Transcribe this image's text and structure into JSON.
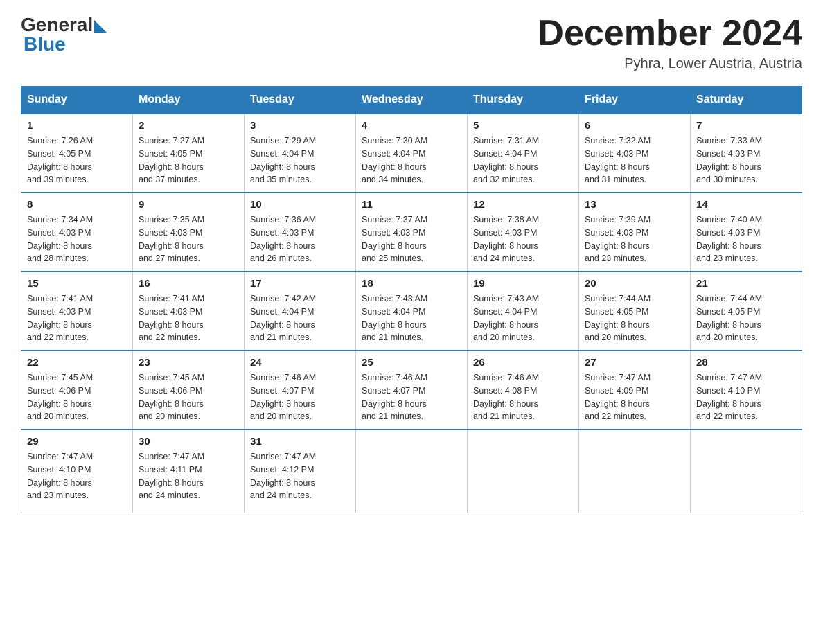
{
  "logo": {
    "general": "General",
    "blue": "Blue"
  },
  "header": {
    "month_year": "December 2024",
    "location": "Pyhra, Lower Austria, Austria"
  },
  "days_of_week": [
    "Sunday",
    "Monday",
    "Tuesday",
    "Wednesday",
    "Thursday",
    "Friday",
    "Saturday"
  ],
  "weeks": [
    [
      {
        "day": "1",
        "info": "Sunrise: 7:26 AM\nSunset: 4:05 PM\nDaylight: 8 hours\nand 39 minutes."
      },
      {
        "day": "2",
        "info": "Sunrise: 7:27 AM\nSunset: 4:05 PM\nDaylight: 8 hours\nand 37 minutes."
      },
      {
        "day": "3",
        "info": "Sunrise: 7:29 AM\nSunset: 4:04 PM\nDaylight: 8 hours\nand 35 minutes."
      },
      {
        "day": "4",
        "info": "Sunrise: 7:30 AM\nSunset: 4:04 PM\nDaylight: 8 hours\nand 34 minutes."
      },
      {
        "day": "5",
        "info": "Sunrise: 7:31 AM\nSunset: 4:04 PM\nDaylight: 8 hours\nand 32 minutes."
      },
      {
        "day": "6",
        "info": "Sunrise: 7:32 AM\nSunset: 4:03 PM\nDaylight: 8 hours\nand 31 minutes."
      },
      {
        "day": "7",
        "info": "Sunrise: 7:33 AM\nSunset: 4:03 PM\nDaylight: 8 hours\nand 30 minutes."
      }
    ],
    [
      {
        "day": "8",
        "info": "Sunrise: 7:34 AM\nSunset: 4:03 PM\nDaylight: 8 hours\nand 28 minutes."
      },
      {
        "day": "9",
        "info": "Sunrise: 7:35 AM\nSunset: 4:03 PM\nDaylight: 8 hours\nand 27 minutes."
      },
      {
        "day": "10",
        "info": "Sunrise: 7:36 AM\nSunset: 4:03 PM\nDaylight: 8 hours\nand 26 minutes."
      },
      {
        "day": "11",
        "info": "Sunrise: 7:37 AM\nSunset: 4:03 PM\nDaylight: 8 hours\nand 25 minutes."
      },
      {
        "day": "12",
        "info": "Sunrise: 7:38 AM\nSunset: 4:03 PM\nDaylight: 8 hours\nand 24 minutes."
      },
      {
        "day": "13",
        "info": "Sunrise: 7:39 AM\nSunset: 4:03 PM\nDaylight: 8 hours\nand 23 minutes."
      },
      {
        "day": "14",
        "info": "Sunrise: 7:40 AM\nSunset: 4:03 PM\nDaylight: 8 hours\nand 23 minutes."
      }
    ],
    [
      {
        "day": "15",
        "info": "Sunrise: 7:41 AM\nSunset: 4:03 PM\nDaylight: 8 hours\nand 22 minutes."
      },
      {
        "day": "16",
        "info": "Sunrise: 7:41 AM\nSunset: 4:03 PM\nDaylight: 8 hours\nand 22 minutes."
      },
      {
        "day": "17",
        "info": "Sunrise: 7:42 AM\nSunset: 4:04 PM\nDaylight: 8 hours\nand 21 minutes."
      },
      {
        "day": "18",
        "info": "Sunrise: 7:43 AM\nSunset: 4:04 PM\nDaylight: 8 hours\nand 21 minutes."
      },
      {
        "day": "19",
        "info": "Sunrise: 7:43 AM\nSunset: 4:04 PM\nDaylight: 8 hours\nand 20 minutes."
      },
      {
        "day": "20",
        "info": "Sunrise: 7:44 AM\nSunset: 4:05 PM\nDaylight: 8 hours\nand 20 minutes."
      },
      {
        "day": "21",
        "info": "Sunrise: 7:44 AM\nSunset: 4:05 PM\nDaylight: 8 hours\nand 20 minutes."
      }
    ],
    [
      {
        "day": "22",
        "info": "Sunrise: 7:45 AM\nSunset: 4:06 PM\nDaylight: 8 hours\nand 20 minutes."
      },
      {
        "day": "23",
        "info": "Sunrise: 7:45 AM\nSunset: 4:06 PM\nDaylight: 8 hours\nand 20 minutes."
      },
      {
        "day": "24",
        "info": "Sunrise: 7:46 AM\nSunset: 4:07 PM\nDaylight: 8 hours\nand 20 minutes."
      },
      {
        "day": "25",
        "info": "Sunrise: 7:46 AM\nSunset: 4:07 PM\nDaylight: 8 hours\nand 21 minutes."
      },
      {
        "day": "26",
        "info": "Sunrise: 7:46 AM\nSunset: 4:08 PM\nDaylight: 8 hours\nand 21 minutes."
      },
      {
        "day": "27",
        "info": "Sunrise: 7:47 AM\nSunset: 4:09 PM\nDaylight: 8 hours\nand 22 minutes."
      },
      {
        "day": "28",
        "info": "Sunrise: 7:47 AM\nSunset: 4:10 PM\nDaylight: 8 hours\nand 22 minutes."
      }
    ],
    [
      {
        "day": "29",
        "info": "Sunrise: 7:47 AM\nSunset: 4:10 PM\nDaylight: 8 hours\nand 23 minutes."
      },
      {
        "day": "30",
        "info": "Sunrise: 7:47 AM\nSunset: 4:11 PM\nDaylight: 8 hours\nand 24 minutes."
      },
      {
        "day": "31",
        "info": "Sunrise: 7:47 AM\nSunset: 4:12 PM\nDaylight: 8 hours\nand 24 minutes."
      },
      null,
      null,
      null,
      null
    ]
  ]
}
